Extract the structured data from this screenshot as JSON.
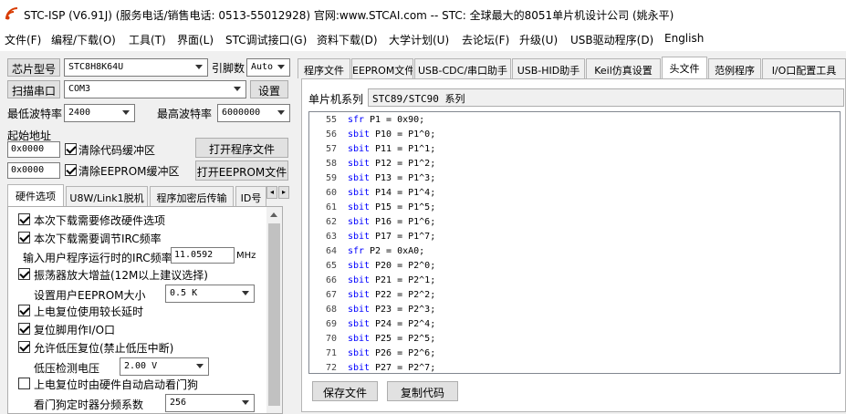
{
  "window": {
    "title": "STC-ISP (V6.91J) (服务电话/销售电话: 0513-55012928) 官网:www.STCAI.com  -- STC: 全球最大的8051单片机设计公司 (姚永平)"
  },
  "menu": [
    "文件(F)",
    "编程/下载(O)",
    "工具(T)",
    "界面(L)",
    "STC调试接口(G)",
    "资料下载(D)",
    "大学计划(U)",
    "去论坛(F)",
    "升级(U)",
    "USB驱动程序(D)",
    "English"
  ],
  "left": {
    "chip_label": "芯片型号",
    "chip_value": "STC8H8K64U",
    "cipher_label": "引脚数",
    "cipher_value": "Auto",
    "scan_button": "扫描串口",
    "port_value": "COM3",
    "settings_button": "设置",
    "min_baud_label": "最低波特率",
    "min_baud_value": "2400",
    "max_baud_label": "最高波特率",
    "max_baud_value": "6000000",
    "start_addr_label": "起始地址",
    "addr1_value": "0x0000",
    "clear_code_label": "清除代码缓冲区",
    "open_prog_button": "打开程序文件",
    "addr2_value": "0x0000",
    "clear_eeprom_label": "清除EEPROM缓冲区",
    "open_eeprom_button": "打开EEPROM文件",
    "tabs": [
      "硬件选项",
      "U8W/Link1脱机",
      "程序加密后传输",
      "ID号"
    ],
    "options": [
      {
        "label": "本次下载需要修改硬件选项",
        "checked": true
      },
      {
        "label": "本次下载需要调节IRC频率",
        "checked": true
      }
    ],
    "irc_label": "输入用户程序运行时的IRC频率",
    "irc_value": "11.0592",
    "irc_unit": "MHz",
    "osc_label": "振荡器放大增益(12M以上建议选择)",
    "eeprom_size_label": "设置用户EEPROM大小",
    "eeprom_size_value": "0.5 K",
    "por_delay_label": "上电复位使用较长延时",
    "reset_pin_label": "复位脚用作I/O口",
    "lvr_label": "允许低压复位(禁止低压中断)",
    "lvr_voltage_label": "低压检测电压",
    "lvr_voltage_value": "2.00 V",
    "wdt_label": "上电复位时由硬件自动启动看门狗",
    "wdt_div_label": "看门狗定时器分频系数",
    "wdt_div_value": "256"
  },
  "right": {
    "tabs": [
      "程序文件",
      "EEPROM文件",
      "USB-CDC/串口助手",
      "USB-HID助手",
      "Keil仿真设置",
      "头文件",
      "范例程序",
      "I/O口配置工具"
    ],
    "series_label": "单片机系列",
    "series_value": "STC89/STC90 系列",
    "code_lines": [
      {
        "n": "55",
        "kw": "sfr",
        "rest": "P1   = 0x90;"
      },
      {
        "n": "56",
        "kw": "sbit",
        "rest": "P10 = P1^0;"
      },
      {
        "n": "57",
        "kw": "sbit",
        "rest": "P11 = P1^1;"
      },
      {
        "n": "58",
        "kw": "sbit",
        "rest": "P12 = P1^2;"
      },
      {
        "n": "59",
        "kw": "sbit",
        "rest": "P13 = P1^3;"
      },
      {
        "n": "60",
        "kw": "sbit",
        "rest": "P14 = P1^4;"
      },
      {
        "n": "61",
        "kw": "sbit",
        "rest": "P15 = P1^5;"
      },
      {
        "n": "62",
        "kw": "sbit",
        "rest": "P16 = P1^6;"
      },
      {
        "n": "63",
        "kw": "sbit",
        "rest": "P17 = P1^7;"
      },
      {
        "n": "64",
        "kw": "sfr",
        "rest": "P2   = 0xA0;"
      },
      {
        "n": "65",
        "kw": "sbit",
        "rest": "P20 = P2^0;"
      },
      {
        "n": "66",
        "kw": "sbit",
        "rest": "P21 = P2^1;"
      },
      {
        "n": "67",
        "kw": "sbit",
        "rest": "P22 = P2^2;"
      },
      {
        "n": "68",
        "kw": "sbit",
        "rest": "P23 = P2^3;"
      },
      {
        "n": "69",
        "kw": "sbit",
        "rest": "P24 = P2^4;"
      },
      {
        "n": "70",
        "kw": "sbit",
        "rest": "P25 = P2^5;"
      },
      {
        "n": "71",
        "kw": "sbit",
        "rest": "P26 = P2^6;"
      },
      {
        "n": "72",
        "kw": "sbit",
        "rest": "P27 = P2^7;"
      }
    ],
    "save_button": "保存文件",
    "copy_button": "复制代码"
  },
  "colors": {
    "keyword": "#0000ff",
    "accent": "#d83b01"
  }
}
